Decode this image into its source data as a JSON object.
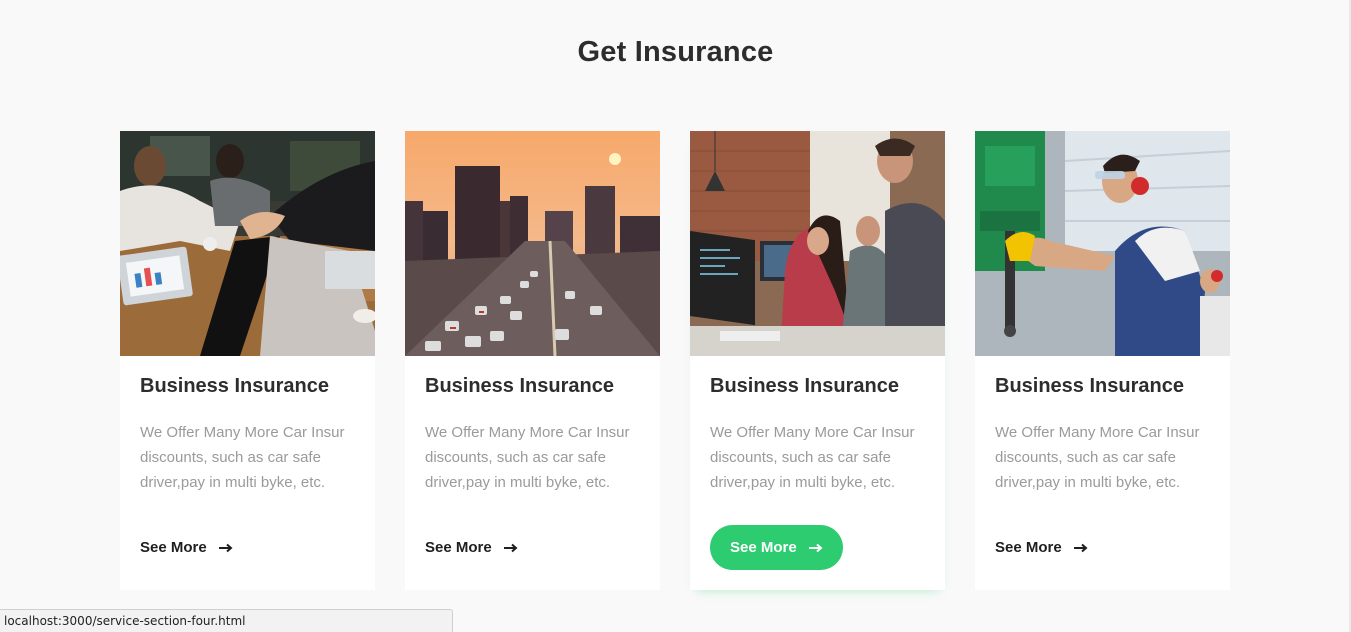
{
  "section": {
    "title": "Get Insurance"
  },
  "cards": [
    {
      "image": "team-hands-stack-photo",
      "title": "Business Insurance",
      "description": "We Offer Many More Car Insur discounts, such as car safe driver,pay in multi byke, etc.",
      "link_label": "See More",
      "link_icon": "arrow-right-icon",
      "active": false
    },
    {
      "image": "city-traffic-sunset-photo",
      "title": "Business Insurance",
      "description": "We Offer Many More Car Insur discounts, such as car safe driver,pay in multi byke, etc.",
      "link_label": "See More",
      "link_icon": "arrow-right-icon",
      "active": false
    },
    {
      "image": "office-developers-photo",
      "title": "Business Insurance",
      "description": "We Offer Many More Car Insur discounts, such as car safe driver,pay in multi byke, etc.",
      "link_label": "See More",
      "link_icon": "arrow-right-icon",
      "active": true
    },
    {
      "image": "factory-worker-drill-photo",
      "title": "Business Insurance",
      "description": "We Offer Many More Car Insur discounts, such as car safe driver,pay in multi byke, etc.",
      "link_label": "See More",
      "link_icon": "arrow-right-icon",
      "active": false
    }
  ],
  "status_bar": {
    "url": "localhost:3000/service-section-four.html"
  },
  "colors": {
    "accent": "#2ecc71",
    "heading": "#2d2d2d",
    "body_text": "#9a9a9a",
    "page_background": "#f9f9f9",
    "card_background": "#ffffff"
  }
}
